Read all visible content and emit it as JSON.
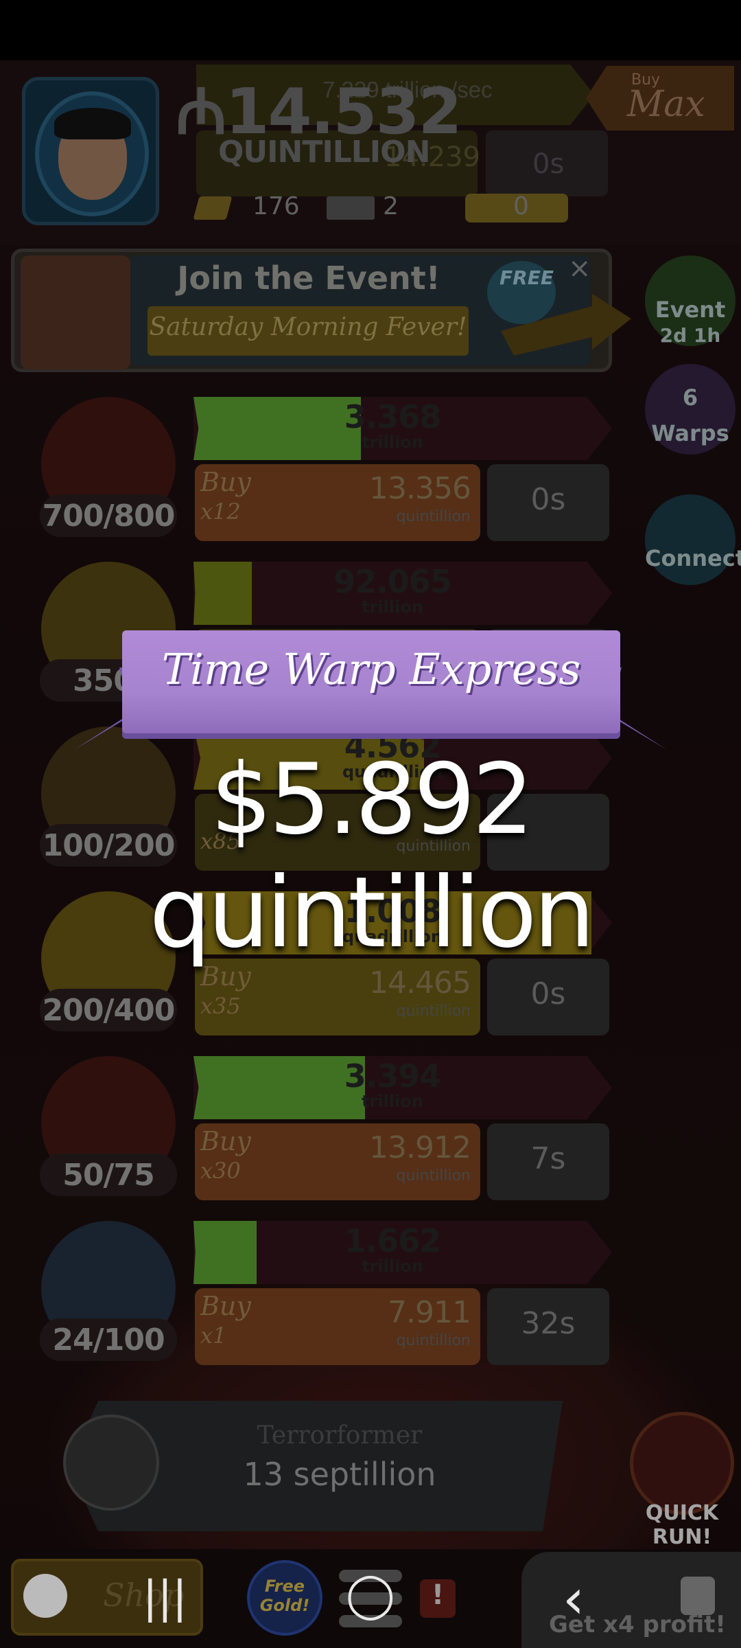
{
  "hud": {
    "money_value": "₼14.532",
    "money_unit": "QUINTILLION",
    "rate": "7.229 trillion /sec",
    "gems": "176",
    "tickets": "2",
    "coupons": "0",
    "buy_small": "Buy",
    "buy_big": "Max",
    "ghost_cost": "14.239",
    "ghost_timer": "0s"
  },
  "event_banner": {
    "title": "Join the Event!",
    "subtitle": "Saturday Morning Fever!",
    "free_label": "FREE",
    "close": "×"
  },
  "side_buttons": {
    "event_label": "Event",
    "event_time": "2d 1h",
    "warps_count": "6",
    "warps_label": "Warps",
    "connect_label": "Connect"
  },
  "managers": [
    {
      "count": "700/800",
      "bar_value": "3.368",
      "bar_unit": "trillion",
      "progress": 0.4,
      "bar_color": "#4f8a2a",
      "buy_label": "Buy",
      "buy_mult": "x12",
      "cost": "13.356",
      "cost_unit": "quintillion",
      "timer": "0s",
      "buy_color": "#6a3a1c",
      "avatar_color": "#3a1410"
    },
    {
      "count": "350/",
      "bar_value": "92.065",
      "bar_unit": "trillion",
      "progress": 0.14,
      "bar_color": "#5e6a12",
      "buy_label": "",
      "buy_mult": "",
      "cost": "",
      "cost_unit": "",
      "timer": "",
      "buy_color": "#3a3412",
      "avatar_color": "#4a3e10"
    },
    {
      "count": "100/200",
      "bar_value": "4.562",
      "bar_unit": "quadrillion",
      "progress": 0.55,
      "bar_color": "#6a5e12",
      "buy_label": "",
      "buy_mult": "x85",
      "cost": "",
      "cost_unit": "quintillion",
      "timer": "",
      "buy_color": "#3a3412",
      "avatar_color": "#3a2c14"
    },
    {
      "count": "200/400",
      "bar_value": "1.008",
      "bar_unit": "quadrillion",
      "progress": 0.95,
      "bar_color": "#7a6a12",
      "buy_label": "Buy",
      "buy_mult": "x35",
      "cost": "14.465",
      "cost_unit": "quintillion",
      "timer": "0s",
      "buy_color": "#5a4e12",
      "avatar_color": "#5a4a10"
    },
    {
      "count": "50/75",
      "bar_value": "3.394",
      "bar_unit": "trillion",
      "progress": 0.41,
      "bar_color": "#4f8a2a",
      "buy_label": "Buy",
      "buy_mult": "x30",
      "cost": "13.912",
      "cost_unit": "quintillion",
      "timer": "7s",
      "buy_color": "#6a3a1c",
      "avatar_color": "#3a1410"
    },
    {
      "count": "24/100",
      "bar_value": "1.662",
      "bar_unit": "trillion",
      "progress": 0.15,
      "bar_color": "#4f8a2a",
      "buy_label": "Buy",
      "buy_mult": "x1",
      "cost": "7.911",
      "cost_unit": "quintillion",
      "timer": "32s",
      "buy_color": "#6a3a1c",
      "avatar_color": "#1f2a3a"
    }
  ],
  "terraformer": {
    "name": "Terrorformer",
    "cost": "13 septillion"
  },
  "quick_run": "QUICK RUN!",
  "bottom": {
    "shop": "Shop",
    "free_gold": "Free Gold!",
    "alert": "!",
    "x4": "Get x4 profit!"
  },
  "popup": {
    "ribbon": "Time Warp Express",
    "prize": "$5.892 quintillion"
  },
  "system_nav": {
    "recents": "|||",
    "home": "◯",
    "back": "‹"
  }
}
